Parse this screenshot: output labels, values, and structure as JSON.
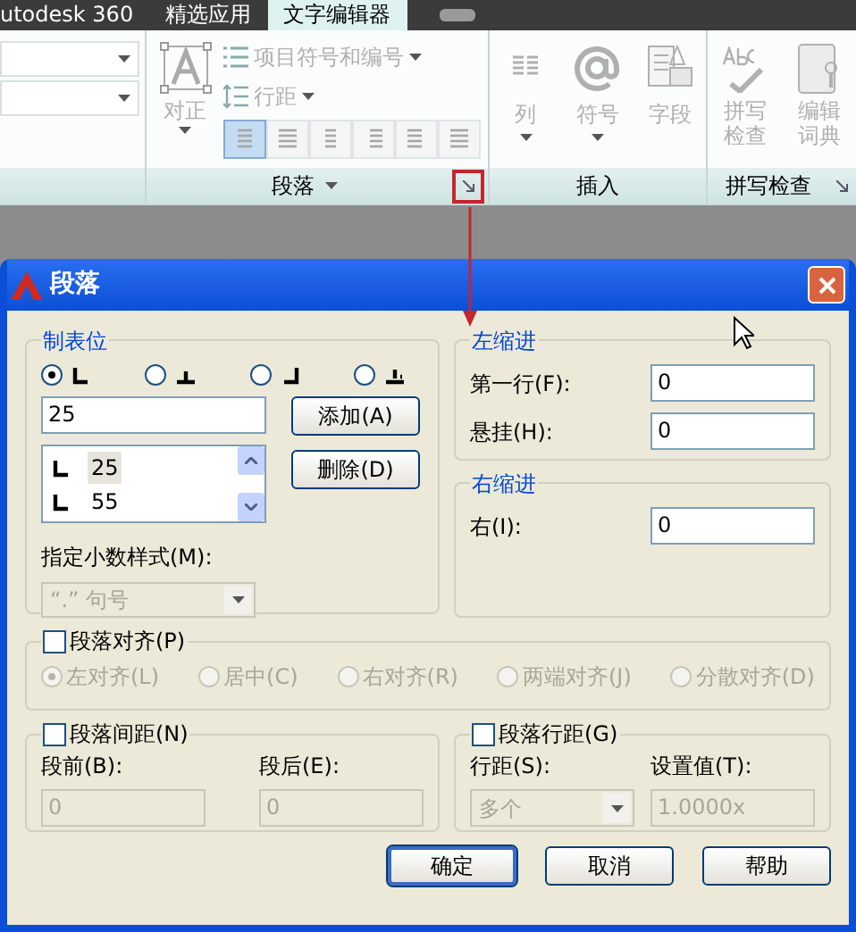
{
  "tabs": [
    {
      "label": "utodesk 360",
      "selected": false
    },
    {
      "label": "精选应用",
      "selected": false
    },
    {
      "label": "文字编辑器",
      "selected": true
    }
  ],
  "paragraph_panel": {
    "label": "段落",
    "justify": "对正",
    "bullets": "项目符号和编号",
    "line_spacing": "行距",
    "align_buttons": [
      {
        "selected": true
      },
      {
        "selected": false
      },
      {
        "selected": false
      },
      {
        "selected": false
      },
      {
        "selected": false
      },
      {
        "selected": false
      }
    ]
  },
  "insert_panel": {
    "label": "插入",
    "tools": [
      {
        "kind": "columns",
        "label": "列"
      },
      {
        "kind": "symbol",
        "label": "符号"
      },
      {
        "kind": "field",
        "label": "字段"
      }
    ]
  },
  "spelling_panel": {
    "label": "拼写检查",
    "tools": [
      {
        "kind": "spellcheck",
        "label": "拼写检查"
      },
      {
        "kind": "dictionary",
        "label": "编辑词典"
      }
    ]
  },
  "dialog": {
    "title": "段落",
    "tabs_group": {
      "title": "制表位",
      "tab_types": [
        {
          "kind": "left",
          "selected": true
        },
        {
          "kind": "center",
          "selected": false
        },
        {
          "kind": "right",
          "selected": false
        },
        {
          "kind": "decimal",
          "selected": false
        }
      ],
      "value": "25",
      "add_button": "添加(A)",
      "delete_button": "删除(D)",
      "stops": [
        {
          "label": "25",
          "selected": true
        },
        {
          "label": "55",
          "selected": false
        }
      ],
      "decimal_label": "指定小数样式(M):",
      "decimal_value": "“.” 句号"
    },
    "left_indent": {
      "title": "左缩进",
      "fields": [
        {
          "label": "第一行(F):",
          "value": "0"
        },
        {
          "label": "悬挂(H):",
          "value": "0"
        }
      ]
    },
    "right_indent": {
      "title": "右缩进",
      "fields": [
        {
          "label": "右(I):",
          "value": "0"
        }
      ]
    },
    "alignment": {
      "label": "段落对齐(P)",
      "checked": false,
      "options": [
        {
          "label": "左对齐(L)",
          "selected": true
        },
        {
          "label": "居中(C)",
          "selected": false
        },
        {
          "label": "右对齐(R)",
          "selected": false
        },
        {
          "label": "两端对齐(J)",
          "selected": false
        },
        {
          "label": "分散对齐(D)",
          "selected": false
        }
      ]
    },
    "spacing": {
      "label": "段落间距(N)",
      "checked": false,
      "before_label": "段前(B):",
      "before_value": "0",
      "after_label": "段后(E):",
      "after_value": "0"
    },
    "line_spacing": {
      "label": "段落行距(G)",
      "checked": false,
      "spacing_label": "行距(S):",
      "spacing_value": "多个",
      "value_label": "设置值(T):",
      "value": "1.0000x"
    },
    "buttons": [
      {
        "label": "确定",
        "default": true
      },
      {
        "label": "取消",
        "default": false
      },
      {
        "label": "帮助",
        "default": false
      }
    ]
  }
}
